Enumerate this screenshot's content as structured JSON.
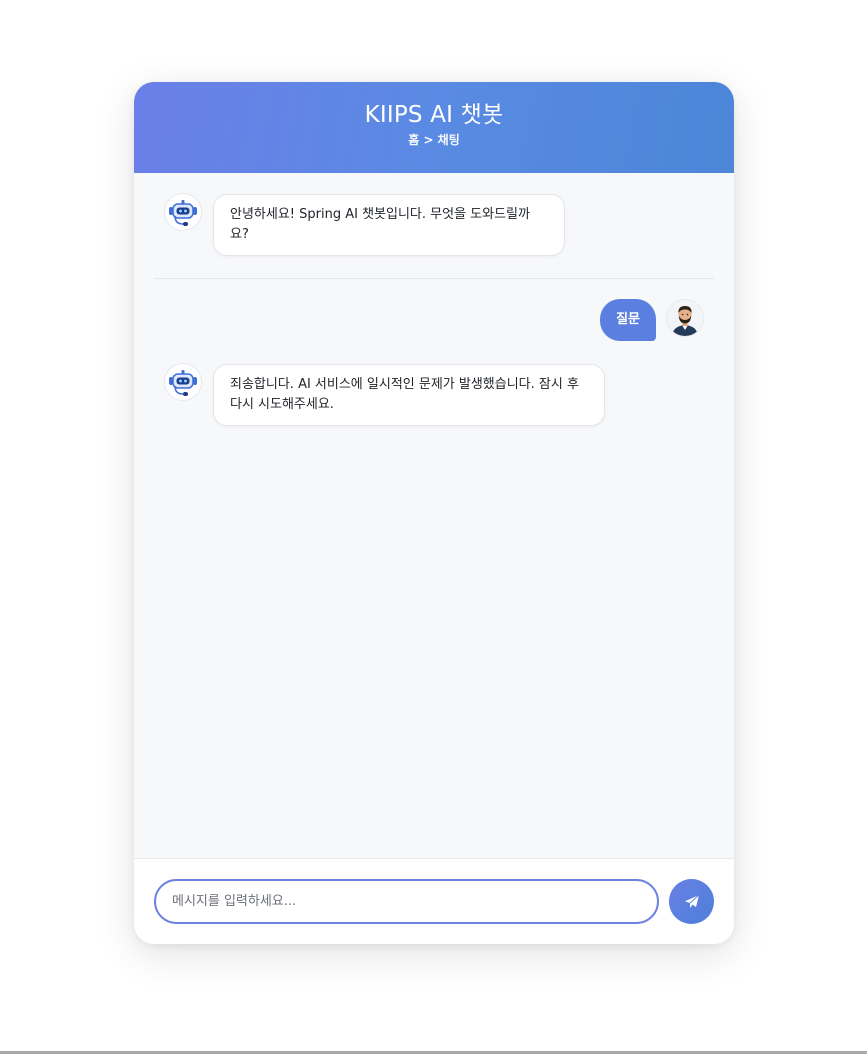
{
  "header": {
    "title": "KIIPS AI 챗봇",
    "breadcrumb": "홈 > 채팅"
  },
  "messages": [
    {
      "sender": "bot",
      "avatar_icon": "robot-icon",
      "text": "안녕하세요! Spring AI 챗봇입니다. 무엇을 도와드릴까요?"
    },
    {
      "sender": "user",
      "avatar_icon": "user-avatar-icon",
      "text": "질문"
    },
    {
      "sender": "bot",
      "avatar_icon": "robot-icon",
      "text": "죄송합니다. AI 서비스에 일시적인 문제가 발생했습니다. 잠시 후 다시 시도해주세요."
    }
  ],
  "input": {
    "placeholder": "메시지를 입력하세요...",
    "value": ""
  },
  "send_button": {
    "icon": "paper-plane-icon"
  },
  "colors": {
    "header_gradient_start": "#6b7fe8",
    "header_gradient_end": "#4b86d8",
    "user_bubble": "#5b7fe0",
    "input_border": "#6d82df",
    "chat_background": "#f7f8fa"
  }
}
